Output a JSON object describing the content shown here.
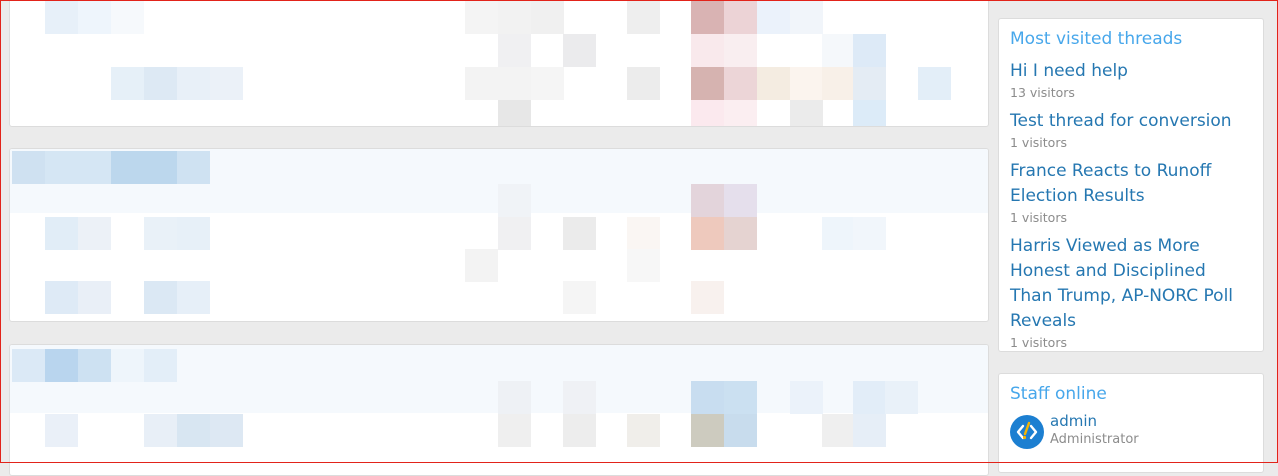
{
  "sidebar": {
    "most_visited": {
      "title": "Most visited threads",
      "threads": [
        {
          "title": "Hi I need help",
          "meta": "13 visitors"
        },
        {
          "title": "Test thread for conversion",
          "meta": "1 visitors"
        },
        {
          "title": "France Reacts to Runoff Election Results",
          "meta": "1 visitors"
        },
        {
          "title": "Harris Viewed as More Honest and Disciplined Than Trump, AP-NORC Poll Reveals",
          "meta": "1 visitors"
        }
      ]
    },
    "staff_online": {
      "title": "Staff online",
      "members": [
        {
          "name": "admin",
          "role": "Administrator",
          "avatar_icon": "code-logo-icon"
        }
      ]
    }
  },
  "colors": {
    "link": "#2577b1",
    "block_title": "#47a7eb",
    "muted": "#8c8c8c",
    "avatar_bg": "#1c7fd1",
    "frame": "#e2231a"
  }
}
